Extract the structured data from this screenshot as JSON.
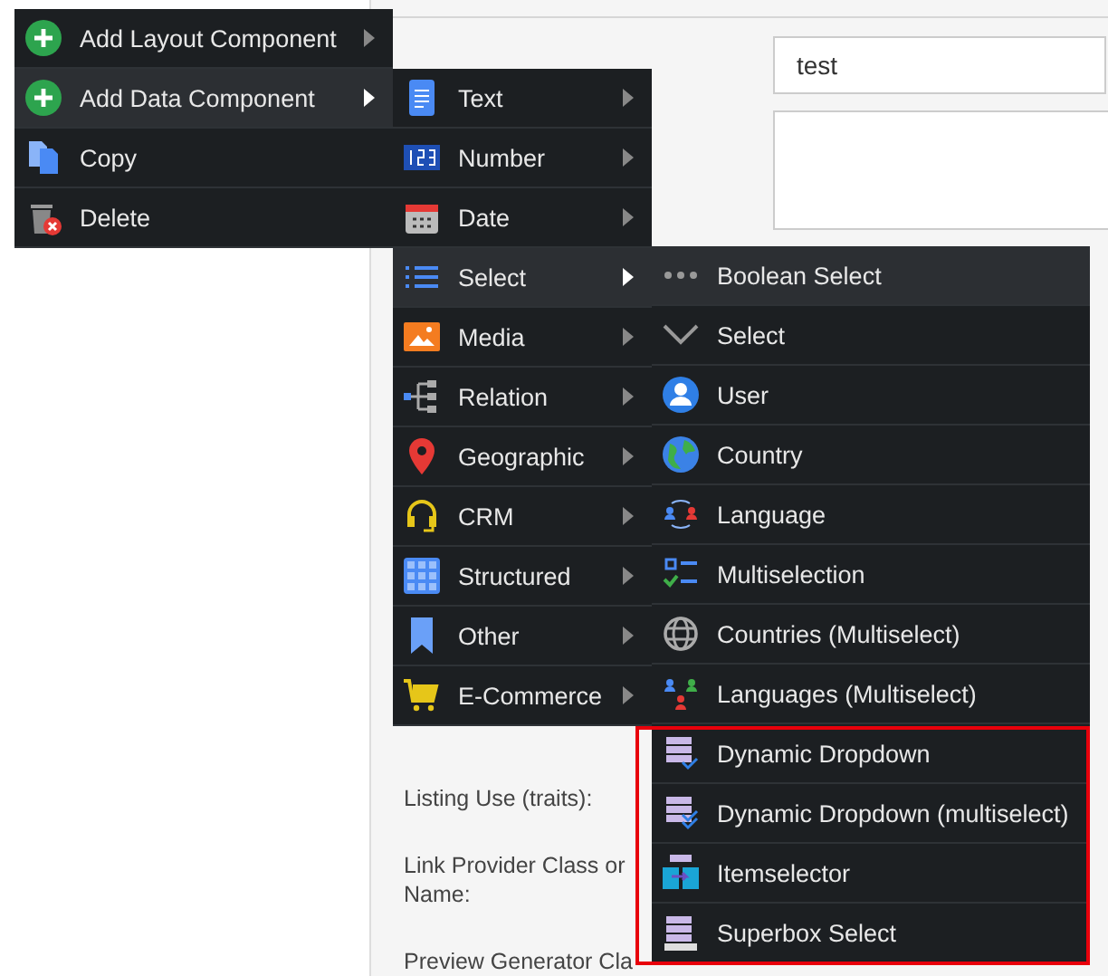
{
  "form": {
    "name_field": {
      "value": "test"
    },
    "labels": [
      {
        "lines": [
          "Listing Use (traits):"
        ]
      },
      {
        "lines": [
          "Link Provider Class or",
          "Name:"
        ]
      },
      {
        "lines": [
          "Preview Generator Cla"
        ]
      }
    ]
  },
  "context_menu": {
    "items": [
      {
        "label": "Add Layout Component",
        "selected": false,
        "has_submenu": true
      },
      {
        "label": "Add Data Component",
        "selected": true,
        "has_submenu": true
      },
      {
        "label": "Copy",
        "selected": false,
        "has_submenu": false
      },
      {
        "label": "Delete",
        "selected": false,
        "has_submenu": false
      }
    ]
  },
  "data_component_menu": {
    "items": [
      {
        "label": "Text",
        "selected": false,
        "has_submenu": true
      },
      {
        "label": "Number",
        "selected": false,
        "has_submenu": true
      },
      {
        "label": "Date",
        "selected": false,
        "has_submenu": true
      },
      {
        "label": "Select",
        "selected": true,
        "has_submenu": true
      },
      {
        "label": "Media",
        "selected": false,
        "has_submenu": true
      },
      {
        "label": "Relation",
        "selected": false,
        "has_submenu": true
      },
      {
        "label": "Geographic",
        "selected": false,
        "has_submenu": true
      },
      {
        "label": "CRM",
        "selected": false,
        "has_submenu": true
      },
      {
        "label": "Structured",
        "selected": false,
        "has_submenu": true
      },
      {
        "label": "Other",
        "selected": false,
        "has_submenu": true
      },
      {
        "label": "E-Commerce",
        "selected": false,
        "has_submenu": true
      }
    ]
  },
  "select_menu": {
    "items": [
      {
        "label": "Boolean Select",
        "selected": true
      },
      {
        "label": "Select",
        "selected": false
      },
      {
        "label": "User",
        "selected": false
      },
      {
        "label": "Country",
        "selected": false
      },
      {
        "label": "Language",
        "selected": false
      },
      {
        "label": "Multiselection",
        "selected": false
      },
      {
        "label": "Countries (Multiselect)",
        "selected": false
      },
      {
        "label": "Languages (Multiselect)",
        "selected": false
      }
    ],
    "outlined_items": [
      {
        "label": "Dynamic Dropdown",
        "selected": false
      },
      {
        "label": "Dynamic Dropdown (multiselect)",
        "selected": false
      },
      {
        "label": "Itemselector",
        "selected": false
      },
      {
        "label": "Superbox Select",
        "selected": false
      }
    ]
  }
}
